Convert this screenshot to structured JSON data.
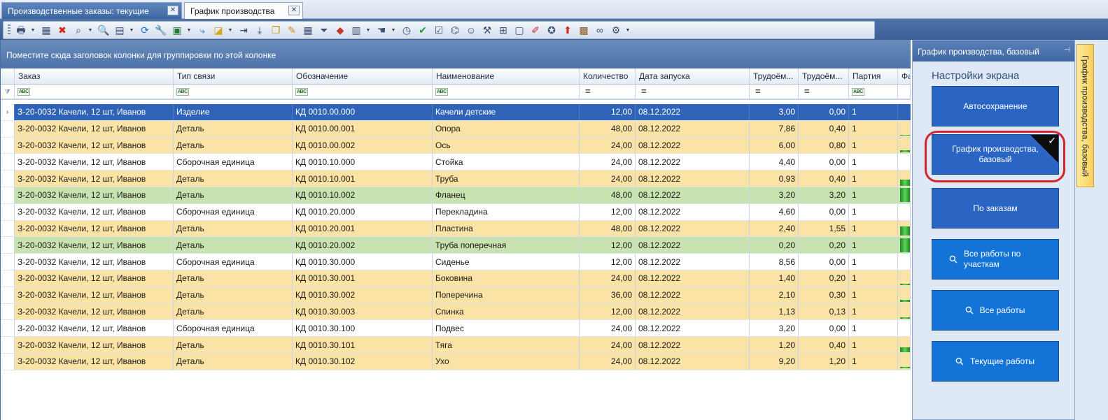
{
  "tabs": [
    {
      "label": "Производственные заказы: текущие",
      "active": false
    },
    {
      "label": "График производства",
      "active": true
    }
  ],
  "toolbar": {
    "icons": [
      "printer-icon",
      "calendar-icon",
      "delete-icon",
      "search-zoom-icon",
      "find-icon",
      "chart-icon",
      "refresh-icon",
      "wrench-icon",
      "excel-icon",
      "share-icon",
      "tag-icon",
      "arrow-right-icon",
      "download-icon",
      "copy-icon",
      "edit-icon",
      "calendar-grid-icon",
      "filter-icon",
      "shapes-icon",
      "clipboard-icon",
      "hand-icon",
      "clock-icon",
      "check-icon",
      "checklist-icon",
      "binoculars-icon",
      "users-icon",
      "hammer-icon",
      "hierarchy-icon",
      "window-icon",
      "pencil-icon",
      "seal-icon",
      "up-arrow-icon",
      "boxes-icon",
      "link-icon",
      "settings-icon"
    ]
  },
  "grid": {
    "group_hint": "Поместите сюда заголовок колонки для группировки по этой колонке",
    "columns": [
      "Заказ",
      "Тип связи",
      "Обозначение",
      "Наименование",
      "Количество",
      "Дата запуска",
      "Трудоём...",
      "Трудоём...",
      "Партия",
      "Фа"
    ],
    "rows": [
      {
        "order": "З-20-0032 Качели, 12 шт, Иванов",
        "type": "Изделие",
        "code": "КД 0010.00.000",
        "name": "Качели детские",
        "qty": "12,00",
        "date": "08.12.2022",
        "t1": "3,00",
        "t2": "0,00",
        "batch": "1",
        "color": "selected",
        "progress": 0
      },
      {
        "order": "З-20-0032 Качели, 12 шт, Иванов",
        "type": "Деталь",
        "code": "КД 0010.00.001",
        "name": "Опора",
        "qty": "48,00",
        "date": "08.12.2022",
        "t1": "7,86",
        "t2": "0,40",
        "batch": "1",
        "color": "orange",
        "progress": 0.05
      },
      {
        "order": "З-20-0032 Качели, 12 шт, Иванов",
        "type": "Деталь",
        "code": "КД 0010.00.002",
        "name": "Ось",
        "qty": "24,00",
        "date": "08.12.2022",
        "t1": "6,00",
        "t2": "0,80",
        "batch": "1",
        "color": "orange",
        "progress": 0.13
      },
      {
        "order": "З-20-0032 Качели, 12 шт, Иванов",
        "type": "Сборочная единица",
        "code": "КД 0010.10.000",
        "name": "Стойка",
        "qty": "24,00",
        "date": "08.12.2022",
        "t1": "4,40",
        "t2": "0,00",
        "batch": "1",
        "color": "white",
        "progress": 0
      },
      {
        "order": "З-20-0032 Качели, 12 шт, Иванов",
        "type": "Деталь",
        "code": "КД 0010.10.001",
        "name": "Труба",
        "qty": "24,00",
        "date": "08.12.2022",
        "t1": "0,93",
        "t2": "0,40",
        "batch": "1",
        "color": "orange",
        "progress": 0.43
      },
      {
        "order": "З-20-0032 Качели, 12 шт, Иванов",
        "type": "Деталь",
        "code": "КД 0010.10.002",
        "name": "Фланец",
        "qty": "48,00",
        "date": "08.12.2022",
        "t1": "3,20",
        "t2": "3,20",
        "batch": "1",
        "color": "green",
        "progress": 1
      },
      {
        "order": "З-20-0032 Качели, 12 шт, Иванов",
        "type": "Сборочная единица",
        "code": "КД 0010.20.000",
        "name": "Перекладина",
        "qty": "12,00",
        "date": "08.12.2022",
        "t1": "4,60",
        "t2": "0,00",
        "batch": "1",
        "color": "white",
        "progress": 0
      },
      {
        "order": "З-20-0032 Качели, 12 шт, Иванов",
        "type": "Деталь",
        "code": "КД 0010.20.001",
        "name": "Пластина",
        "qty": "48,00",
        "date": "08.12.2022",
        "t1": "2,40",
        "t2": "1,55",
        "batch": "1",
        "color": "orange",
        "progress": 0.65
      },
      {
        "order": "З-20-0032 Качели, 12 шт, Иванов",
        "type": "Деталь",
        "code": "КД 0010.20.002",
        "name": "Труба поперечная",
        "qty": "12,00",
        "date": "08.12.2022",
        "t1": "0,20",
        "t2": "0,20",
        "batch": "1",
        "color": "green",
        "progress": 1
      },
      {
        "order": "З-20-0032 Качели, 12 шт, Иванов",
        "type": "Сборочная единица",
        "code": "КД 0010.30.000",
        "name": "Сиденье",
        "qty": "12,00",
        "date": "08.12.2022",
        "t1": "8,56",
        "t2": "0,00",
        "batch": "1",
        "color": "white",
        "progress": 0
      },
      {
        "order": "З-20-0032 Качели, 12 шт, Иванов",
        "type": "Деталь",
        "code": "КД 0010.30.001",
        "name": "Боковина",
        "qty": "24,00",
        "date": "08.12.2022",
        "t1": "1,40",
        "t2": "0,20",
        "batch": "1",
        "color": "orange",
        "progress": 0.14
      },
      {
        "order": "З-20-0032 Качели, 12 шт, Иванов",
        "type": "Деталь",
        "code": "КД 0010.30.002",
        "name": "Поперечина",
        "qty": "36,00",
        "date": "08.12.2022",
        "t1": "2,10",
        "t2": "0,30",
        "batch": "1",
        "color": "orange",
        "progress": 0.14
      },
      {
        "order": "З-20-0032 Качели, 12 шт, Иванов",
        "type": "Деталь",
        "code": "КД 0010.30.003",
        "name": "Спинка",
        "qty": "12,00",
        "date": "08.12.2022",
        "t1": "1,13",
        "t2": "0,13",
        "batch": "1",
        "color": "orange",
        "progress": 0.12
      },
      {
        "order": "З-20-0032 Качели, 12 шт, Иванов",
        "type": "Сборочная единица",
        "code": "КД 0010.30.100",
        "name": "Подвес",
        "qty": "24,00",
        "date": "08.12.2022",
        "t1": "3,20",
        "t2": "0,00",
        "batch": "1",
        "color": "white",
        "progress": 0
      },
      {
        "order": "З-20-0032 Качели, 12 шт, Иванов",
        "type": "Деталь",
        "code": "КД 0010.30.101",
        "name": "Тяга",
        "qty": "24,00",
        "date": "08.12.2022",
        "t1": "1,20",
        "t2": "0,40",
        "batch": "1",
        "color": "orange",
        "progress": 0.33
      },
      {
        "order": "З-20-0032 Качели, 12 шт, Иванов",
        "type": "Деталь",
        "code": "КД 0010.30.102",
        "name": "Ухо",
        "qty": "24,00",
        "date": "08.12.2022",
        "t1": "9,20",
        "t2": "1,20",
        "batch": "1",
        "color": "orange",
        "progress": 0.13
      }
    ]
  },
  "right_panel": {
    "header": "График производства, базовый",
    "title": "Настройки экрана",
    "buttons": [
      {
        "label": "Автосохранение",
        "search": false,
        "checked": false,
        "style": "dark"
      },
      {
        "label": "График производства, базовый",
        "search": false,
        "checked": true,
        "style": "dark"
      },
      {
        "label": "По заказам",
        "search": false,
        "checked": false,
        "style": "dark"
      },
      {
        "label": "Все работы по участкам",
        "search": true,
        "checked": false,
        "style": "bright"
      },
      {
        "label": "Все работы",
        "search": true,
        "checked": false,
        "style": "bright"
      },
      {
        "label": "Текущие работы",
        "search": true,
        "checked": false,
        "style": "bright"
      }
    ]
  },
  "side_tab": {
    "label": "График производства, базовый"
  }
}
